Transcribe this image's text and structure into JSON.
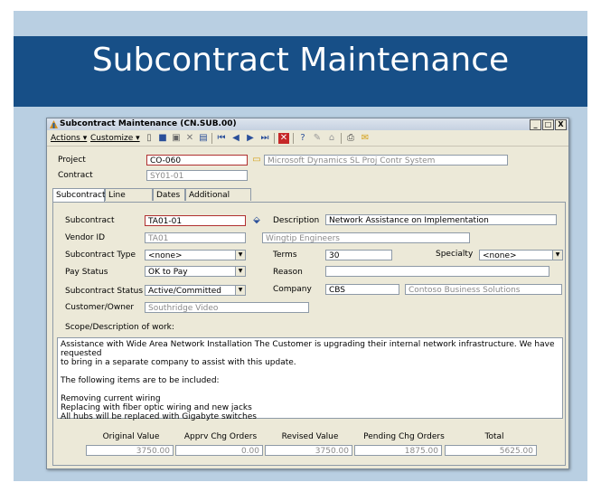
{
  "slide": {
    "title": "Subcontract Maintenance"
  },
  "window": {
    "title": "Subcontract Maintenance (CN.SUB.00)",
    "controls": [
      "_",
      "□",
      "X"
    ]
  },
  "menu": {
    "actions": "Actions ▾",
    "customize": "Customize ▾"
  },
  "header": {
    "project_label": "Project",
    "project_value": "CO-060",
    "project_desc": "Microsoft Dynamics SL Proj Contr System",
    "contract_label": "Contract",
    "contract_value": "SY01-01"
  },
  "tabs": [
    "Subcontract",
    "Line Items",
    "Dates",
    "Additional Info"
  ],
  "form": {
    "subcontract_label": "Subcontract",
    "subcontract_value": "TA01-01",
    "description_label": "Description",
    "description_value": "Network Assistance on Implementation",
    "vendor_label": "Vendor ID",
    "vendor_value": "TA01",
    "vendor_name": "Wingtip Engineers",
    "type_label": "Subcontract Type",
    "type_value": "<none>",
    "terms_label": "Terms",
    "terms_value": "30",
    "specialty_label": "Specialty",
    "specialty_value": "<none>",
    "paystatus_label": "Pay Status",
    "paystatus_value": "OK to Pay",
    "reason_label": "Reason",
    "reason_value": "",
    "status_label": "Subcontract Status",
    "status_value": "Active/Committed",
    "company_label": "Company",
    "company_value": "CBS",
    "company_name": "Contoso Business Solutions",
    "customer_label": "Customer/Owner",
    "customer_value": "Southridge Video",
    "scope_label": "Scope/Description of work:"
  },
  "scope_lines": [
    "Assistance with Wide Area Network Installation   The Customer is upgrading their internal network infrastructure.  We have requested",
    "to bring in a separate company to assist with this update.",
    "",
    "The following items are to be included:",
    "",
    "Removing current wiring",
    "Replacing with fiber optic wiring and new jacks",
    "All hubs will be replaced with Gigabyte switches"
  ],
  "totals": {
    "original_label": "Original Value",
    "original_value": "3750.00",
    "apprv_label": "Apprv Chg Orders",
    "apprv_value": "0.00",
    "revised_label": "Revised Value",
    "revised_value": "3750.00",
    "pending_label": "Pending Chg Orders",
    "pending_value": "1875.00",
    "total_label": "Total",
    "total_value": "5625.00"
  },
  "colors": {
    "title_band": "#174f87",
    "slide_bg": "#b9cfe2",
    "window_bg": "#ece9d8"
  }
}
